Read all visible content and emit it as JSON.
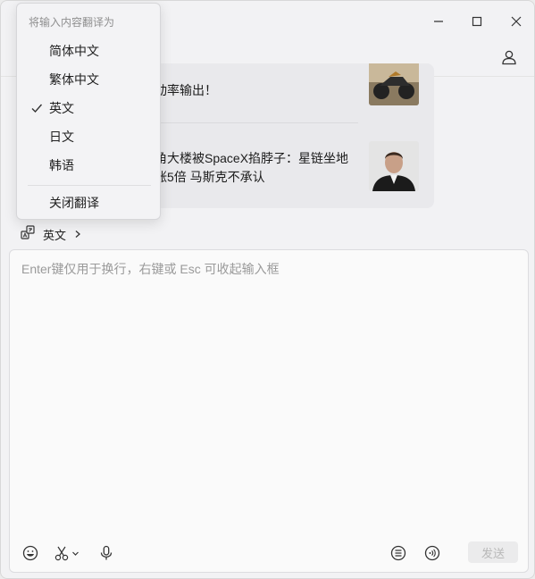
{
  "window": {
    "controls": [
      "minimize-icon",
      "maximize-icon",
      "close-icon"
    ],
    "profile_icon": "person-icon"
  },
  "news": [
    {
      "text": "动率输出！",
      "thumb": "motorcycle-image"
    },
    {
      "text": "角大楼被SpaceX掐脖子：星链坐地涨5倍 马斯克不承认",
      "thumb": "portrait-image"
    }
  ],
  "translate": {
    "icon": "translate-icon",
    "target": "英文"
  },
  "input": {
    "placeholder": "Enter键仅用于换行，右键或 Esc 可收起输入框"
  },
  "toolbar": {
    "icons": [
      "emoji-icon",
      "scissors-icon",
      "microphone-icon",
      "list-icon",
      "voice-icon"
    ],
    "send_label": "发送"
  },
  "menu": {
    "header": "将输入内容翻译为",
    "items": [
      {
        "label": "简体中文",
        "checked": false
      },
      {
        "label": "繁体中文",
        "checked": false
      },
      {
        "label": "英文",
        "checked": true
      },
      {
        "label": "日文",
        "checked": false
      },
      {
        "label": "韩语",
        "checked": false
      }
    ],
    "close_label": "关闭翻译"
  },
  "colors": {
    "background": "#f2f2f4",
    "menu_bg": "#f3f3f5",
    "send_disabled": "#ebebec"
  }
}
